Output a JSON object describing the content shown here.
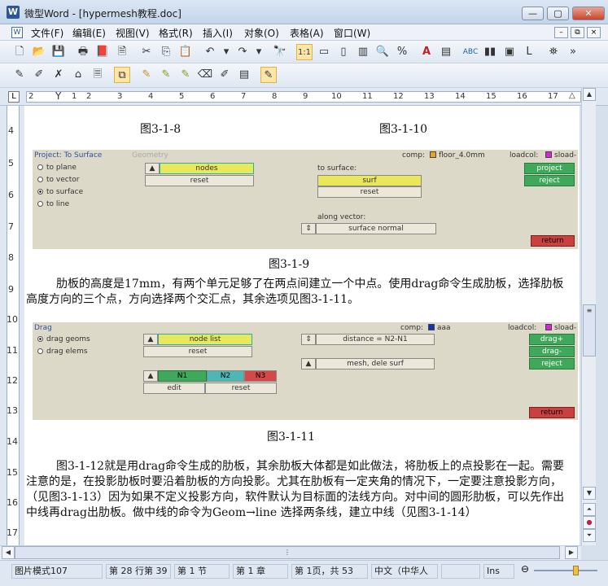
{
  "window": {
    "app_icon_glyph": "W",
    "title": "微型Word - [hypermesh教程.doc]",
    "min": "—",
    "max": "▢",
    "close": "✕"
  },
  "menu": {
    "items": [
      "文件(F)",
      "编辑(E)",
      "视图(V)",
      "格式(R)",
      "插入(I)",
      "对象(O)",
      "表格(A)",
      "窗口(W)"
    ],
    "mdi_min": "–",
    "mdi_restore": "⧉",
    "mdi_close": "×"
  },
  "ruler": {
    "tab_glyph": "L",
    "h_numbers": [
      "2",
      "1",
      "1",
      "2",
      "3",
      "4",
      "5",
      "6",
      "7",
      "8",
      "9",
      "10",
      "11",
      "12",
      "13",
      "14",
      "15",
      "16",
      "17"
    ],
    "v_numbers": [
      "4",
      "5",
      "6",
      "7",
      "8",
      "9",
      "10",
      "11",
      "12",
      "13",
      "14",
      "15",
      "16",
      "17"
    ]
  },
  "document": {
    "caption_318": "图3-1-8",
    "caption_3110": "图3-1-10",
    "panel1": {
      "title": "Project: To Surface",
      "subtitle": "Geometry",
      "comp_label": "comp:",
      "comp_value": "floor_4.0mm",
      "loadcol_label": "loadcol:",
      "loadcol_value": "sload-",
      "radios": [
        "to plane",
        "to vector",
        "to surface",
        "to line"
      ],
      "nodes": "nodes",
      "reset": "reset",
      "to_surface": "to surface:",
      "surf": "surf",
      "reset2": "reset",
      "along_vector": "along vector:",
      "surface_normal": "surface normal",
      "project": "project",
      "reject": "reject",
      "return": "return"
    },
    "caption_319": "图3-1-9",
    "para1": "肋板的高度是17mm，有两个单元足够了在两点间建立一个中点。使用drag命令生成肋板，选择肋板高度方向的三个点，方向选择两个交汇点，其余选项见图3-1-11。",
    "panel2": {
      "title": "Drag",
      "comp_label": "comp:",
      "comp_value": "aaa",
      "loadcol_label": "loadcol:",
      "loadcol_value": "sload-",
      "radios": [
        "drag geoms",
        "drag elems"
      ],
      "node_list": "node list",
      "reset": "reset",
      "distance": "distance = N2-N1",
      "mesh_dele": "mesh, dele surf",
      "n1": "N1",
      "n2": "N2",
      "n3": "N3",
      "edit": "edit",
      "reset2": "reset",
      "drag_plus": "drag+",
      "drag_minus": "drag-",
      "reject": "reject",
      "return": "return"
    },
    "caption_3111": "图3-1-11",
    "para2": "图3-1-12就是用drag命令生成的肋板，其余肋板大体都是如此做法，将肋板上的点投影在一起。需要注意的是，在投影肋板时要沿着肋板的方向投影。尤其在肋板有一定夹角的情况下，一定要注意投影方向，（见图3-1-13）因为如果不定义投影方向，软件默认为目标面的法线方向。对中间的圆形肋板，可以先作出中线再drag出肋板。做中线的命令为Geom→line 选择两条线，建立中线（见图3-1-14）"
  },
  "status": {
    "mode": "图片模式107",
    "pos": "第 28 行第 39",
    "section": "第 1 节",
    "chapter": "第 1 章",
    "page": "第 1页，共 53",
    "lang": "中文（中华人",
    "ins": "Ins"
  },
  "colors": {
    "swatch_orange": "#f0a020",
    "swatch_magenta": "#e020e0",
    "swatch_blue": "#1030c0",
    "panel_title_blue": "#3050a0"
  }
}
